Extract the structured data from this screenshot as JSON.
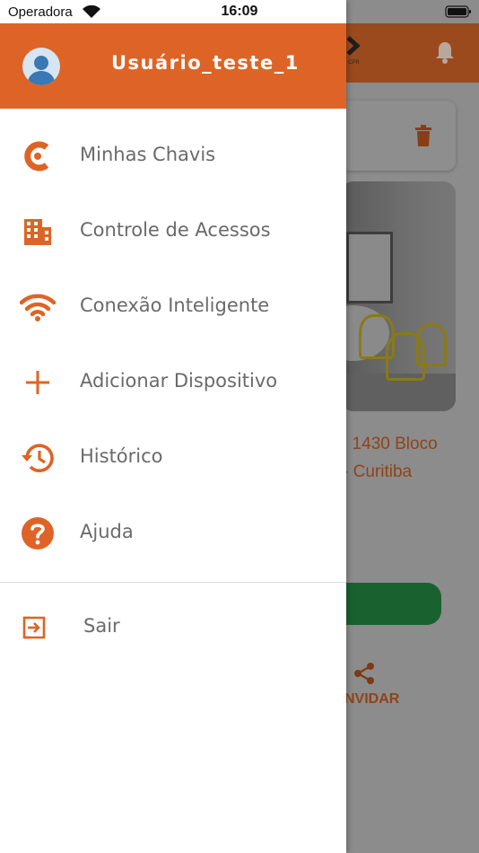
{
  "status_bar": {
    "carrier": "Operadora",
    "time": "16:09"
  },
  "background": {
    "address_line1": ", 1430 Bloco",
    "address_line2": "- Curitiba",
    "invite_label": "NVIDAR",
    "logo_caption": "CPR"
  },
  "drawer": {
    "username": "Usuário_teste_1",
    "menu": [
      {
        "label": "Minhas Chavis",
        "icon": "chavis-logo-icon"
      },
      {
        "label": "Controle de Acessos",
        "icon": "building-icon"
      },
      {
        "label": "Conexão Inteligente",
        "icon": "wifi-icon"
      },
      {
        "label": "Adicionar Dispositivo",
        "icon": "plus-icon"
      },
      {
        "label": "Histórico",
        "icon": "history-icon"
      },
      {
        "label": "Ajuda",
        "icon": "help-icon"
      }
    ],
    "logout": {
      "label": "Sair",
      "icon": "logout-icon"
    }
  },
  "colors": {
    "accent": "#dd6426",
    "menu_text": "#6a6a6a",
    "drawer_bg": "#ffffff",
    "overlay_green": "#19622f"
  }
}
